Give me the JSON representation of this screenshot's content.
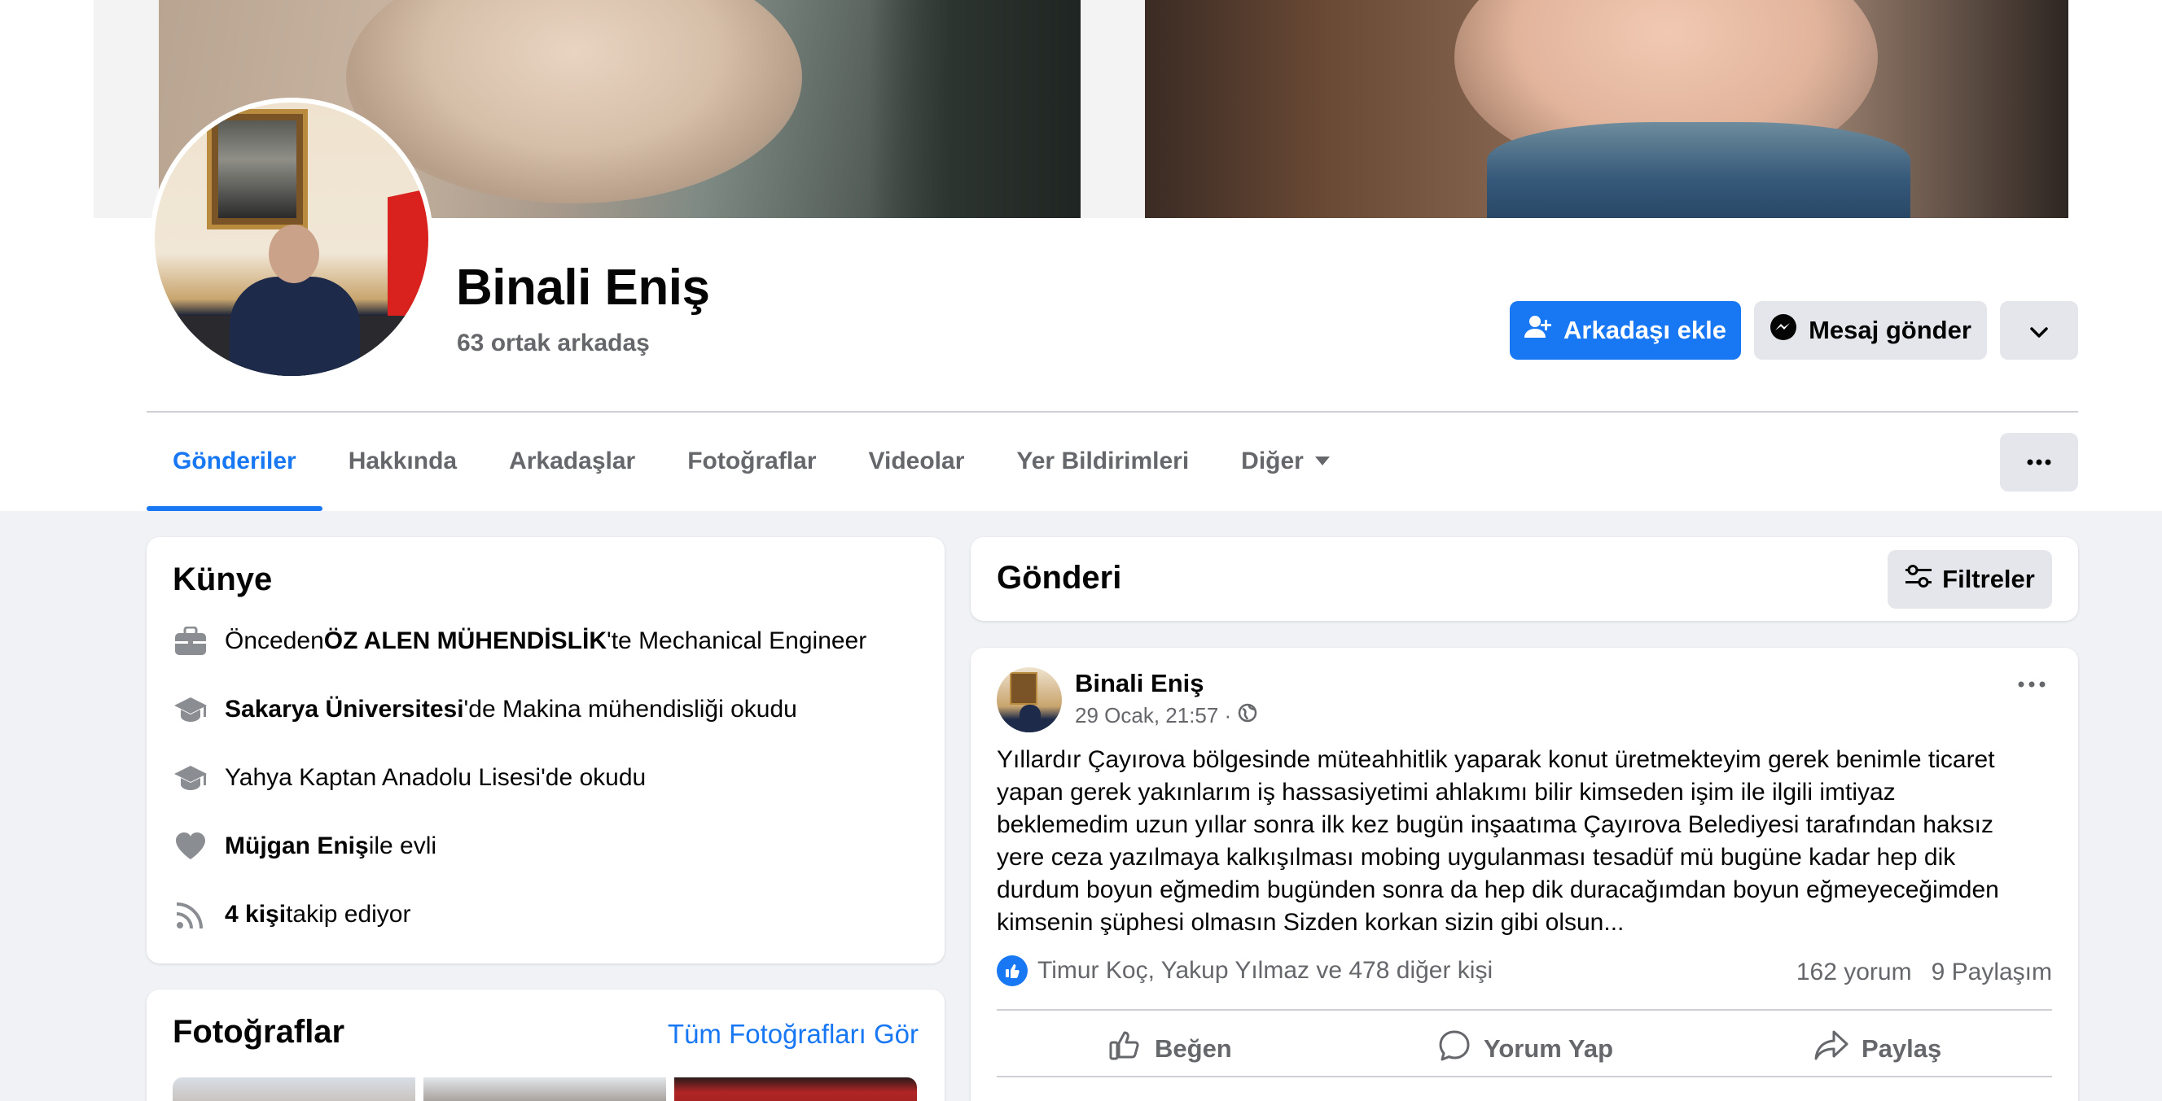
{
  "profile": {
    "name": "Binali Eniş",
    "mutual_friends": "63 ortak arkadaş",
    "add_friend_label": "Arkadaşı ekle",
    "message_label": "Mesaj gönder"
  },
  "tabs": [
    {
      "label": "Gönderiler",
      "active": true
    },
    {
      "label": "Hakkında"
    },
    {
      "label": "Arkadaşlar"
    },
    {
      "label": "Fotoğraflar"
    },
    {
      "label": "Videolar"
    },
    {
      "label": "Yer Bildirimleri"
    },
    {
      "label": "Diğer"
    }
  ],
  "intro": {
    "title": "Künye",
    "items": [
      {
        "icon": "briefcase-icon",
        "pre": "Önceden ",
        "bold": "ÖZ ALEN MÜHENDİSLİK",
        "post": "'te Mechanical Engineer"
      },
      {
        "icon": "graduation-cap-icon",
        "pre": "",
        "bold": "Sakarya Üniversitesi",
        "post": "'de Makina mühendisliği okudu"
      },
      {
        "icon": "graduation-cap-icon",
        "pre": "Yahya Kaptan Anadolu Lisesi'de okudu",
        "bold": "",
        "post": ""
      },
      {
        "icon": "heart-icon",
        "pre": "",
        "bold": "Müjgan Eniş",
        "post": " ile evli"
      },
      {
        "icon": "rss-icon",
        "pre": "",
        "bold": "4 kişi",
        "post": " takip ediyor"
      }
    ]
  },
  "photos": {
    "title": "Fotoğraflar",
    "see_all": "Tüm Fotoğrafları Gör"
  },
  "posts_header": {
    "title": "Gönderi",
    "filter_label": "Filtreler"
  },
  "post": {
    "author": "Binali Eniş",
    "time": "29 Ocak, 21:57 ·",
    "text": "Yıllardır Çayırova bölgesinde  müteahhitlik yaparak konut üretmekteyim gerek benimle ticaret\nyapan gerek yakınlarım iş hassasiyetimi ahlakımı  bilir kimseden işim ile ilgili imtiyaz\nbeklemedim uzun yıllar sonra ilk kez bugün inşaatıma Çayırova Belediyesi tarafından haksız\nyere ceza yazılmaya kalkışılması mobing uygulanması tesadüf mü bugüne kadar hep dik\ndurdum boyun eğmedim bugünden sonra da hep dik duracağımdan boyun eğmeyeceğimden\nkimsenin şüphesi olmasın Sizden korkan sizin gibi olsun...",
    "reactions": "Timur Koç, Yakup Yılmaz ve 478 diğer kişi",
    "comments": "162 yorum",
    "shares": "9 Paylaşım",
    "like_label": "Beğen",
    "comment_label": "Yorum Yap",
    "share_label": "Paylaş"
  },
  "colors": {
    "accent": "#1877f2",
    "secondary_text": "#65676b",
    "button_gray": "#e4e6eb",
    "page_bg": "#f0f2f5"
  }
}
